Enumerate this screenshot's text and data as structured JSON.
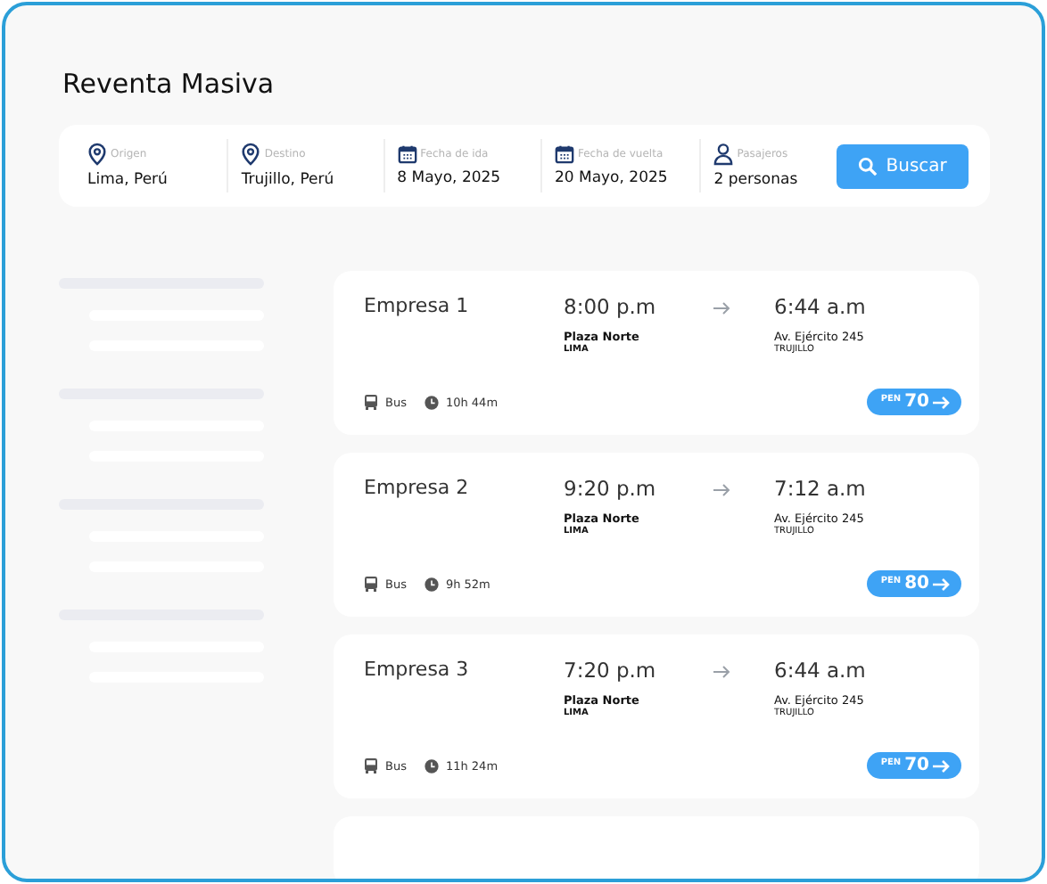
{
  "title": "Reventa Masiva",
  "search": {
    "fields": [
      {
        "kind": "pin",
        "label": "Origen",
        "value": "Lima, Perú"
      },
      {
        "kind": "pin",
        "label": "Destino",
        "value": "Trujillo, Perú"
      },
      {
        "kind": "calendar",
        "label": "Fecha de ida",
        "value": "8 Mayo, 2025"
      },
      {
        "kind": "calendar",
        "label": "Fecha de vuelta",
        "value": "20 Mayo, 2025"
      },
      {
        "kind": "person",
        "label": "Pasajeros",
        "value": "2 personas"
      }
    ],
    "button": "Buscar"
  },
  "results": [
    {
      "company": "Empresa 1",
      "depart": "8:00 p.m",
      "arrive": "6:44 a.m",
      "from": "Plaza Norte",
      "from_city": "LIMA",
      "to": "Av. Ejército 245",
      "to_city": "TRUJILLO",
      "vehicle": "Bus",
      "duration": "10h 44m",
      "currency": "PEN",
      "price": "70"
    },
    {
      "company": "Empresa 2",
      "depart": "9:20 p.m",
      "arrive": "7:12 a.m",
      "from": "Plaza Norte",
      "from_city": "LIMA",
      "to": "Av. Ejército 245",
      "to_city": "TRUJILLO",
      "vehicle": "Bus",
      "duration": "9h 52m",
      "currency": "PEN",
      "price": "80"
    },
    {
      "company": "Empresa 3",
      "depart": "7:20 p.m",
      "arrive": "6:44 a.m",
      "from": "Plaza Norte",
      "from_city": "LIMA",
      "to": "Av. Ejército 245",
      "to_city": "TRUJILLO",
      "vehicle": "Bus",
      "duration": "11h 24m",
      "currency": "PEN",
      "price": "70"
    }
  ]
}
